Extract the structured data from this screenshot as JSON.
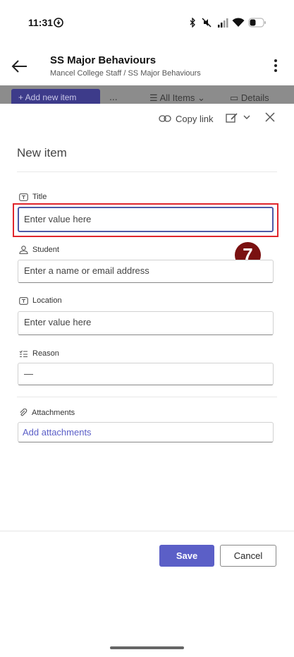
{
  "status_bar": {
    "time": "11:31",
    "icons": [
      "data-saver-icon",
      "bluetooth-icon",
      "mute-icon",
      "signal-icon",
      "wifi-icon",
      "battery-icon"
    ]
  },
  "header": {
    "title": "SS Major Behaviours",
    "breadcrumb": "Mancel College Staff / SS Major Behaviours"
  },
  "command_bar": {
    "add_label": "+ Add new item",
    "more_label": "...",
    "view_label": "All Items",
    "details_label": "Details"
  },
  "panel": {
    "copy_link_label": "Copy link",
    "title": "New item",
    "fields": {
      "title_label": "Title",
      "title_placeholder": "Enter value here",
      "student_label": "Student",
      "student_placeholder": "Enter a name or email address",
      "location_label": "Location",
      "location_placeholder": "Enter value here",
      "reason_label": "Reason",
      "reason_value": "—",
      "attachments_label": "Attachments",
      "attachments_link": "Add attachments"
    },
    "annotation_number": "7",
    "save_label": "Save",
    "cancel_label": "Cancel"
  },
  "colors": {
    "accent": "#5b5fc7",
    "highlight": "#e0262c",
    "badge": "#7a1111"
  }
}
